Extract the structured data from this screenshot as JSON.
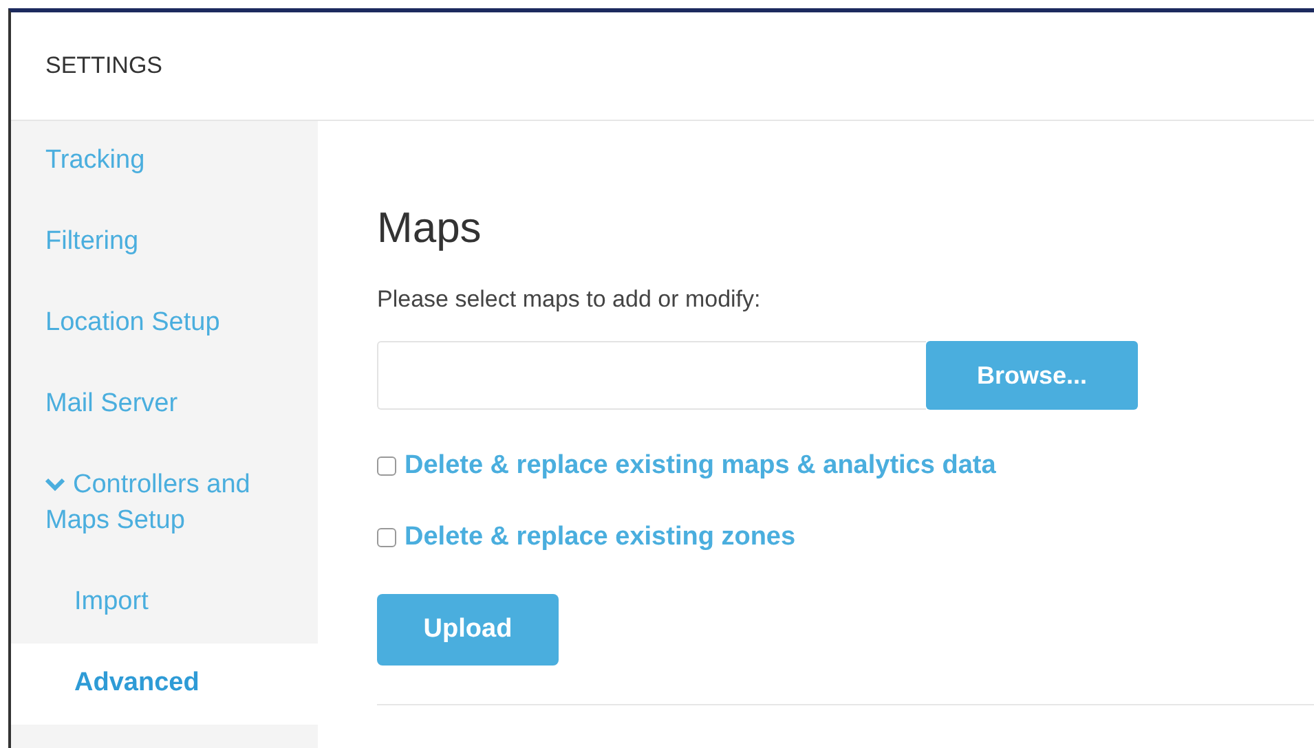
{
  "header": {
    "title": "SETTINGS"
  },
  "sidebar": {
    "items": [
      {
        "label": "Tracking",
        "selected": false
      },
      {
        "label": "Filtering",
        "selected": false
      },
      {
        "label": "Location Setup",
        "selected": false
      },
      {
        "label": "Mail Server",
        "selected": false
      },
      {
        "label": "Controllers and Maps Setup",
        "selected": false,
        "expanded": true,
        "children": [
          {
            "label": "Import",
            "selected": false
          },
          {
            "label": "Advanced",
            "selected": true
          }
        ]
      }
    ]
  },
  "content": {
    "title": "Maps",
    "instruction": "Please select maps to add or modify:",
    "file_field": {
      "button": "Browse..."
    },
    "options": [
      {
        "label": "Delete & replace existing maps & analytics data",
        "checked": false
      },
      {
        "label": "Delete & replace existing zones",
        "checked": false
      }
    ],
    "upload_button": "Upload"
  }
}
